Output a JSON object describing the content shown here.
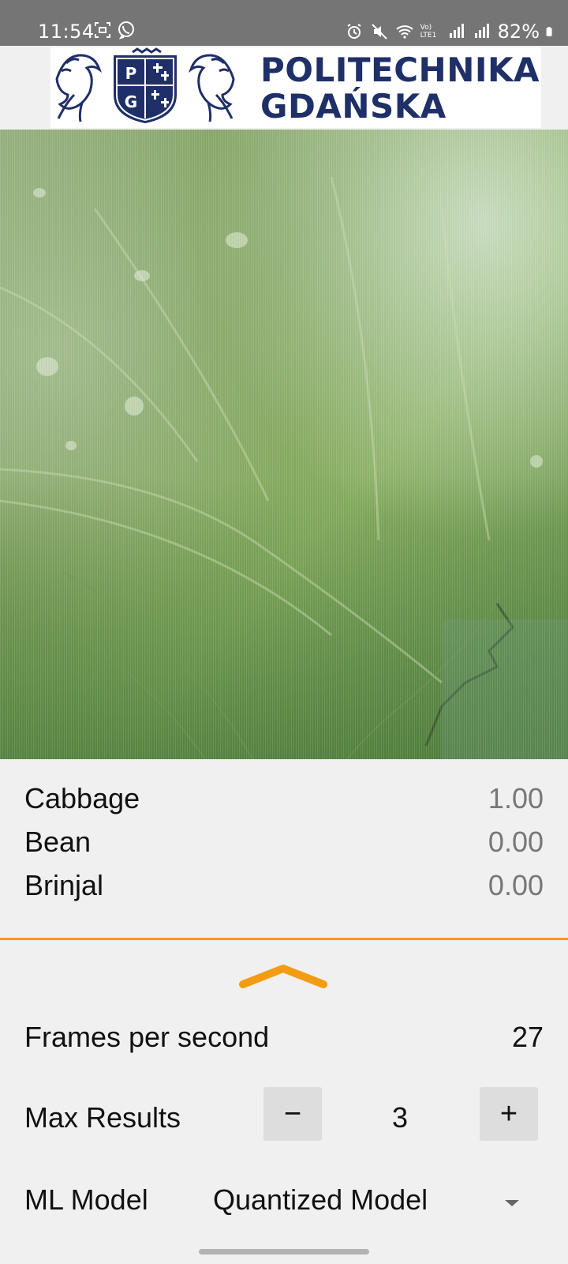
{
  "status_bar": {
    "time": "11:54",
    "battery": "82%",
    "network_label": "Vo) LTE1",
    "icons": [
      "screenshot-icon",
      "viber-icon",
      "alarm-icon",
      "mute-icon",
      "wifi-icon",
      "signal-icon",
      "battery-icon"
    ]
  },
  "header": {
    "logo_line1": "POLITECHNIKA",
    "logo_line2": "GDAŃSKA",
    "emblem_letters": [
      "P",
      "G"
    ],
    "brand_color": "#1f2f68"
  },
  "results": [
    {
      "label": "Cabbage",
      "score": "1.00"
    },
    {
      "label": "Bean",
      "score": "0.00"
    },
    {
      "label": "Brinjal",
      "score": "0.00"
    }
  ],
  "settings": {
    "fps_label": "Frames per second",
    "fps_value": "27",
    "max_results_label": "Max Results",
    "max_results_value": "3",
    "decrement_symbol": "−",
    "increment_symbol": "+",
    "model_label": "ML Model",
    "model_value": "Quantized Model"
  },
  "colors": {
    "accent": "#f39c12",
    "background": "#f0f0f0",
    "status_bar": "#757575",
    "score_text": "#777777"
  }
}
